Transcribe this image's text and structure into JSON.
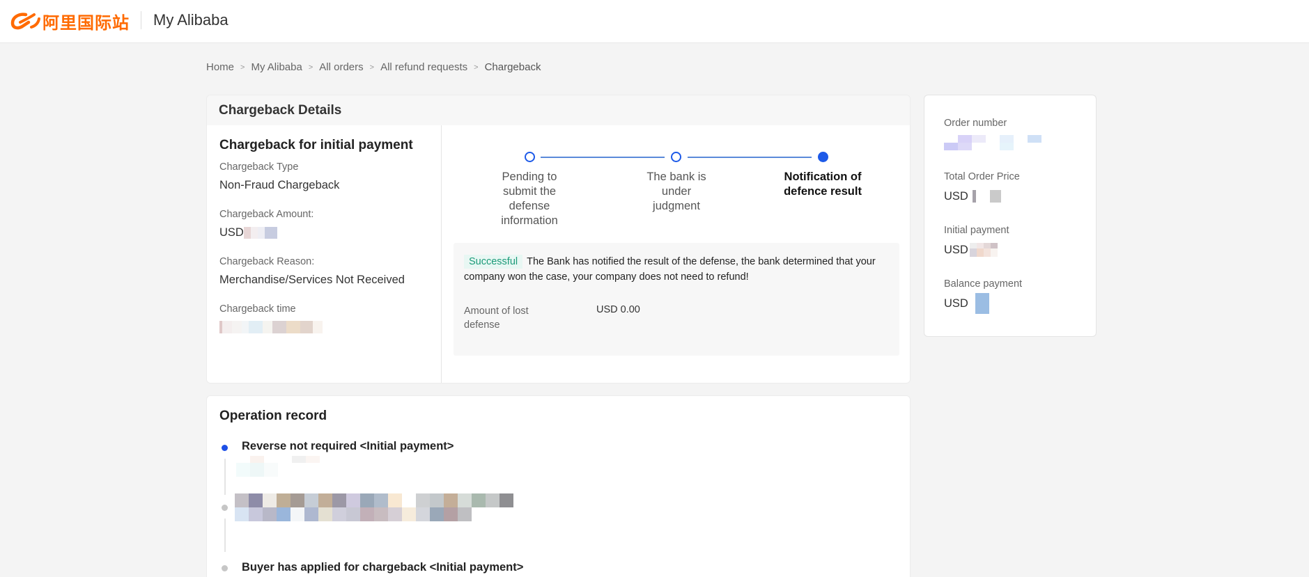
{
  "header": {
    "logo_text": "阿里国际站",
    "title": "My Alibaba"
  },
  "breadcrumb": {
    "items": [
      "Home",
      "My Alibaba",
      "All orders",
      "All refund requests"
    ],
    "current": "Chargeback"
  },
  "chargeback_details": {
    "heading": "Chargeback Details",
    "subheading": "Chargeback for initial payment",
    "type_label": "Chargeback Type",
    "type_value": "Non-Fraud Chargeback",
    "amount_label": "Chargeback Amount:",
    "amount_currency": "USD",
    "reason_label": "Chargeback Reason:",
    "reason_value": "Merchandise/Services Not Received",
    "time_label": "Chargeback time"
  },
  "steps": [
    {
      "label": "Pending to submit the defense information",
      "state": "done"
    },
    {
      "label": "The bank is under judgment",
      "state": "done"
    },
    {
      "label": "Notification of defence result",
      "state": "active"
    }
  ],
  "result": {
    "badge": "Successful",
    "message": "The Bank has notified the result of the defense, the bank determined that your company won the case, your company does not need to refund!",
    "lost_label": "Amount of lost defense",
    "lost_value": "USD 0.00"
  },
  "order_summary": {
    "order_number_label": "Order number",
    "total_label": "Total Order Price",
    "total_currency": "USD",
    "initial_label": "Initial payment",
    "initial_currency": "USD",
    "balance_label": "Balance payment",
    "balance_currency": "USD"
  },
  "operation_record": {
    "title": "Operation record",
    "entries": [
      {
        "title": "Reverse not required  <Initial payment>"
      },
      {
        "title": "Buyer has applied for chargeback  <Initial payment>"
      }
    ]
  },
  "colors": {
    "brand": "#ff6a00",
    "step_blue": "#1d5ae8",
    "success_green": "#1b9a78"
  }
}
